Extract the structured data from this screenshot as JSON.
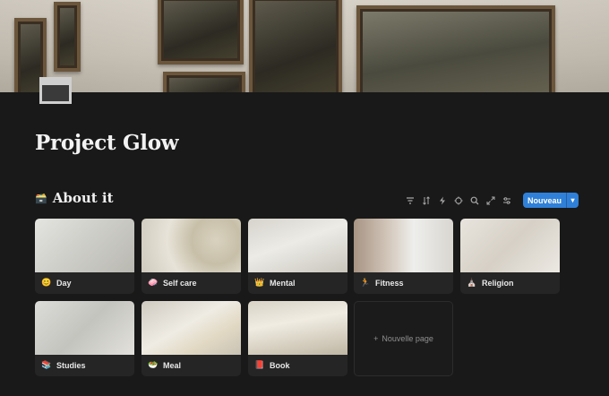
{
  "page": {
    "title": "Project Glow",
    "icon": "calendar-icon"
  },
  "section": {
    "emoji": "🗃️",
    "title": "About it"
  },
  "toolbar": {
    "icons": [
      "filter-icon",
      "sort-icon",
      "automation-icon",
      "ai-icon",
      "search-icon",
      "expand-icon",
      "settings-icon"
    ],
    "new_label": "Nouveau"
  },
  "cards": [
    {
      "icon": "😊",
      "label": "Day"
    },
    {
      "icon": "🧼",
      "label": "Self care"
    },
    {
      "icon": "👑",
      "label": "Mental"
    },
    {
      "icon": "🏃",
      "label": "Fitness"
    },
    {
      "icon": "⛪",
      "label": "Religion"
    },
    {
      "icon": "📚",
      "label": "Studies"
    },
    {
      "icon": "🥗",
      "label": "Meal"
    },
    {
      "icon": "📕",
      "label": "Book"
    }
  ],
  "add_card": {
    "icon": "+",
    "label": "Nouvelle page"
  }
}
